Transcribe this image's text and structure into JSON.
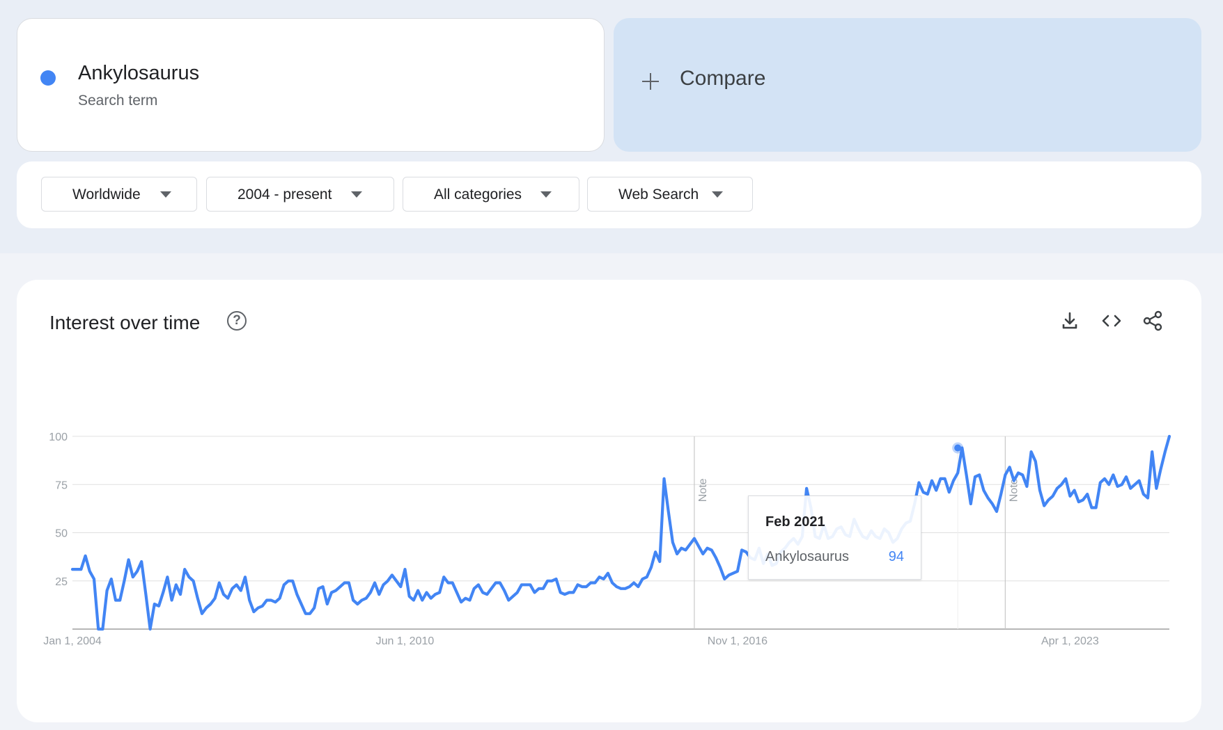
{
  "search_term": {
    "name": "Ankylosaurus",
    "subtitle": "Search term",
    "color": "#4285f4"
  },
  "compare": {
    "label": "Compare",
    "icon": "plus-icon"
  },
  "filters": [
    {
      "label": "Worldwide"
    },
    {
      "label": "2004 - present"
    },
    {
      "label": "All categories"
    },
    {
      "label": "Web Search"
    }
  ],
  "panel": {
    "title": "Interest over time",
    "help_icon": "?",
    "tools": [
      "download-icon",
      "embed-code-icon",
      "share-icon"
    ]
  },
  "tooltip": {
    "date": "Feb 2021",
    "term": "Ankylosaurus",
    "value": "94"
  },
  "chart_data": {
    "type": "line",
    "title": "",
    "xlabel": "",
    "ylabel": "",
    "ylim": [
      0,
      100
    ],
    "yticks": [
      "25",
      "50",
      "75",
      "100"
    ],
    "xtick_labels": [
      "Jan 1, 2004",
      "Jun 1, 2010",
      "Nov 1, 2016",
      "Apr 1, 2023"
    ],
    "notes": [
      {
        "label": "Note",
        "date": "2016-01"
      },
      {
        "label": "Note",
        "date": "2022-01"
      }
    ],
    "highlight": {
      "date": "2021-02",
      "value": 94
    },
    "grid": true,
    "legend": "none",
    "series": [
      {
        "name": "Ankylosaurus",
        "color": "#4285f4",
        "start": "2004-01",
        "frequency": "monthly",
        "values": [
          31,
          31,
          31,
          38,
          30,
          26,
          0,
          0,
          20,
          26,
          15,
          15,
          25,
          36,
          27,
          30,
          35,
          18,
          0,
          13,
          12,
          19,
          27,
          15,
          23,
          18,
          31,
          27,
          25,
          16,
          8,
          11,
          13,
          16,
          24,
          18,
          16,
          21,
          23,
          20,
          27,
          15,
          9,
          11,
          12,
          15,
          15,
          14,
          16,
          23,
          25,
          25,
          18,
          13,
          8,
          8,
          11,
          21,
          22,
          13,
          19,
          20,
          22,
          24,
          24,
          15,
          13,
          15,
          16,
          19,
          24,
          18,
          23,
          25,
          28,
          25,
          22,
          31,
          17,
          15,
          20,
          15,
          19,
          16,
          18,
          19,
          27,
          24,
          24,
          19,
          14,
          16,
          15,
          21,
          23,
          19,
          18,
          21,
          24,
          24,
          20,
          15,
          17,
          19,
          23,
          23,
          23,
          19,
          21,
          21,
          25,
          25,
          26,
          19,
          18,
          19,
          19,
          23,
          22,
          22,
          24,
          24,
          27,
          26,
          29,
          24,
          22,
          21,
          21,
          22,
          24,
          22,
          26,
          27,
          32,
          40,
          35,
          78,
          61,
          45,
          39,
          42,
          41,
          44,
          47,
          43,
          39,
          42,
          41,
          37,
          32,
          26,
          28,
          29,
          30,
          41,
          40,
          37,
          36,
          42,
          34,
          39,
          33,
          34,
          40,
          42,
          45,
          47,
          44,
          48,
          73,
          63,
          48,
          47,
          54,
          47,
          48,
          52,
          53,
          49,
          48,
          57,
          52,
          48,
          47,
          51,
          48,
          47,
          52,
          50,
          45,
          47,
          52,
          55,
          56,
          65,
          76,
          71,
          70,
          77,
          72,
          78,
          78,
          71,
          77,
          81,
          94,
          80,
          65,
          79,
          80,
          72,
          68,
          65,
          61,
          70,
          80,
          84,
          77,
          81,
          80,
          74,
          92,
          87,
          72,
          64,
          67,
          69,
          73,
          75,
          78,
          69,
          72,
          66,
          67,
          70,
          63,
          63,
          76,
          78,
          75,
          80,
          74,
          75,
          79,
          73,
          75,
          77,
          70,
          68,
          92,
          73,
          83,
          92,
          100
        ]
      }
    ]
  }
}
